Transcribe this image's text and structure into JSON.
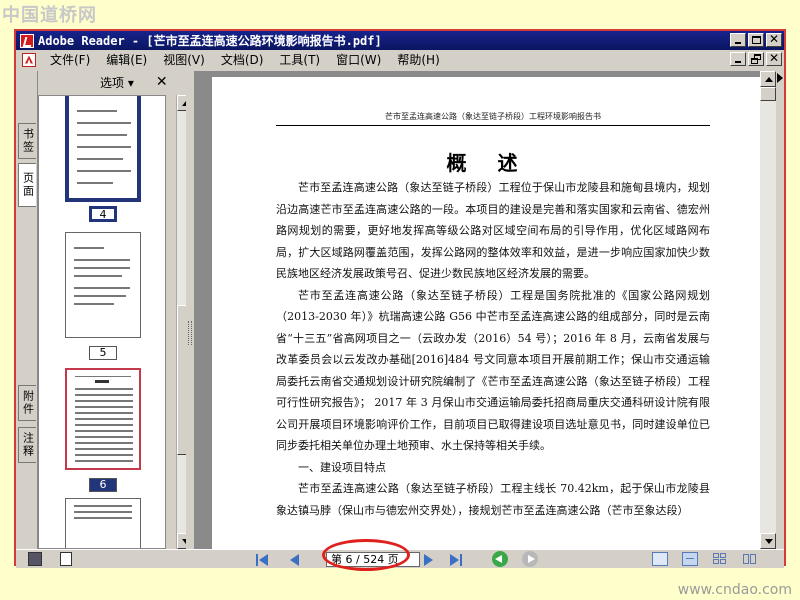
{
  "watermarks": {
    "top_left": "中国道桥网",
    "bottom_right": "www.cndao.com"
  },
  "window": {
    "title": "Adobe Reader - [芒市至孟连高速公路环境影响报告书.pdf]"
  },
  "menu": {
    "items": [
      "文件(F)",
      "编辑(E)",
      "视图(V)",
      "文档(D)",
      "工具(T)",
      "窗口(W)",
      "帮助(H)"
    ]
  },
  "side_tabs": {
    "bookmarks": "书签",
    "pages": "页面",
    "attachments": "附件",
    "comments": "注释"
  },
  "thumb_panel": {
    "options_label": "选项 ▾",
    "close_label": "✕",
    "page_numbers": [
      "4",
      "5",
      "6"
    ]
  },
  "document": {
    "running_head": "芒市至孟连高速公路（象达至链子桥段）工程环境影响报告书",
    "heading": "概 述",
    "paragraphs": [
      "芒市至孟连高速公路（象达至链子桥段）工程位于保山市龙陵县和施甸县境内，规划沿边高速芒市至孟连高速公路的一段。本项目的建设是完善和落实国家和云南省、德宏州路网规划的需要，更好地发挥高等级公路对区域空间布局的引导作用，优化区域路网布局，扩大区域路网覆盖范围，发挥公路网的整体效率和效益，是进一步响应国家加快少数民族地区经济发展政策号召、促进少数民族地区经济发展的需要。",
      "芒市至孟连高速公路（象达至链子桥段）工程是国务院批准的《国家公路网规划（2013-2030 年）》杭瑞高速公路 G56 中芒市至孟连高速公路的组成部分，同时是云南省“十三五”省高网项目之一（云政办发（2016）54 号）；2016 年 8 月，云南省发展与改革委员会以云发改办基础[2016]484 号文同意本项目开展前期工作；保山市交通运输局委托云南省交通规划设计研究院编制了《芒市至孟连高速公路（象达至链子桥段）工程可行性研究报告》； 2017 年 3 月保山市交通运输局委托招商局重庆交通科研设计院有限公司开展项目环境影响评价工作，目前项目已取得建设项目选址意见书，同时建设单位已同步委托相关单位办理土地预审、水土保持等相关手续。",
      "一、建设项目特点",
      "芒市至孟连高速公路（象达至链子桥段）工程主线长 70.42km，起于保山市龙陵县象达镇马脖（保山市与德宏州交界处），接规划芒市至孟连高速公路（芒市至象达段）"
    ]
  },
  "status": {
    "page_indicator": "第 6 / 524 页"
  },
  "colors": {
    "annotation_red": "#e0201c",
    "title_bar": "#0a1560",
    "nav_blue": "#3b6fc4",
    "nav_green": "#3aa84a"
  }
}
